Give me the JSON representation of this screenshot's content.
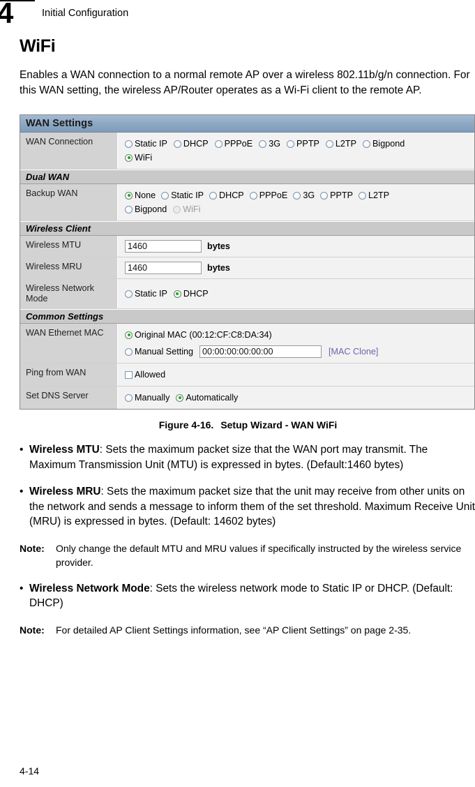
{
  "header": {
    "chapter_number": "4",
    "title": "Initial Configuration"
  },
  "section": {
    "title": "WiFi",
    "intro": "Enables a WAN connection to a normal remote AP over a wireless 802.11b/g/n connection. For this WAN setting, the wireless AP/Router operates as a Wi-Fi client to the remote AP."
  },
  "panel": {
    "title": "WAN Settings",
    "colors": {
      "title_bar": "#8ca7c3",
      "group_bar": "#c9c9c9",
      "label_cell": "#d3d3d3",
      "value_cell": "#f2f2f2",
      "radio_selected": "#22a422",
      "link": "#6f63ab"
    },
    "wan_connection": {
      "label": "WAN Connection",
      "options_line1": [
        {
          "label": "Static IP",
          "selected": false
        },
        {
          "label": "DHCP",
          "selected": false
        },
        {
          "label": "PPPoE",
          "selected": false
        },
        {
          "label": "3G",
          "selected": false
        },
        {
          "label": "PPTP",
          "selected": false
        },
        {
          "label": "L2TP",
          "selected": false
        },
        {
          "label": "Bigpond",
          "selected": false
        }
      ],
      "options_line2": [
        {
          "label": "WiFi",
          "selected": true
        }
      ]
    },
    "dual_wan": {
      "group_label": "Dual WAN",
      "backup_wan": {
        "label": "Backup WAN",
        "options_line1": [
          {
            "label": "None",
            "selected": true
          },
          {
            "label": "Static IP",
            "selected": false
          },
          {
            "label": "DHCP",
            "selected": false
          },
          {
            "label": "PPPoE",
            "selected": false
          },
          {
            "label": "3G",
            "selected": false
          },
          {
            "label": "PPTP",
            "selected": false
          },
          {
            "label": "L2TP",
            "selected": false
          }
        ],
        "options_line2": [
          {
            "label": "Bigpond",
            "selected": false,
            "disabled": false
          },
          {
            "label": "WiFi",
            "selected": false,
            "disabled": true
          }
        ]
      }
    },
    "wireless_client": {
      "group_label": "Wireless Client",
      "wireless_mtu": {
        "label": "Wireless MTU",
        "value": "1460",
        "unit": "bytes"
      },
      "wireless_mru": {
        "label": "Wireless MRU",
        "value": "1460",
        "unit": "bytes"
      },
      "wireless_network_mode": {
        "label": "Wireless Network Mode",
        "options": [
          {
            "label": "Static IP",
            "selected": false
          },
          {
            "label": "DHCP",
            "selected": true
          }
        ]
      }
    },
    "common_settings": {
      "group_label": "Common Settings",
      "wan_ethernet_mac": {
        "label": "WAN Ethernet MAC",
        "original_option": {
          "label": "Original MAC (00:12:CF:C8:DA:34)",
          "selected": true
        },
        "manual_option": {
          "label": "Manual Setting",
          "selected": false
        },
        "manual_value": "00:00:00:00:00:00",
        "clone_link": "[MAC Clone]"
      },
      "ping_from_wan": {
        "label": "Ping from WAN",
        "checkbox_label": "Allowed",
        "checked": false
      },
      "set_dns_server": {
        "label": "Set DNS Server",
        "options": [
          {
            "label": "Manually",
            "selected": false
          },
          {
            "label": "Automatically",
            "selected": true
          }
        ]
      }
    }
  },
  "figure": {
    "number": "Figure 4-16.",
    "caption": "Setup Wizard - WAN WiFi"
  },
  "bullets": [
    {
      "dot": "•",
      "term": "Wireless MTU",
      "text": ": Sets the maximum packet size that the WAN port may transmit. The Maximum Transmission Unit (MTU) is expressed in bytes. (Default:1460 bytes)"
    },
    {
      "dot": "•",
      "term": "Wireless MRU",
      "text": ": Sets the maximum packet size that the unit may receive from other units on the network and sends a message to inform them of the set threshold. Maximum Receive Unit (MRU) is expressed in bytes. (Default: 14602 bytes)"
    },
    {
      "dot": "•",
      "term": "Wireless Network Mode",
      "text": ": Sets the wireless network mode to Static IP or DHCP. (Default: DHCP)"
    }
  ],
  "notes": [
    {
      "label": "Note:",
      "text": "Only change the default MTU and MRU values if specifically instructed by the wireless service provider."
    },
    {
      "label": "Note:",
      "text": "For detailed AP Client Settings information, see “AP Client Settings” on page 2-35."
    }
  ],
  "footer": {
    "page_number": "4-14"
  }
}
